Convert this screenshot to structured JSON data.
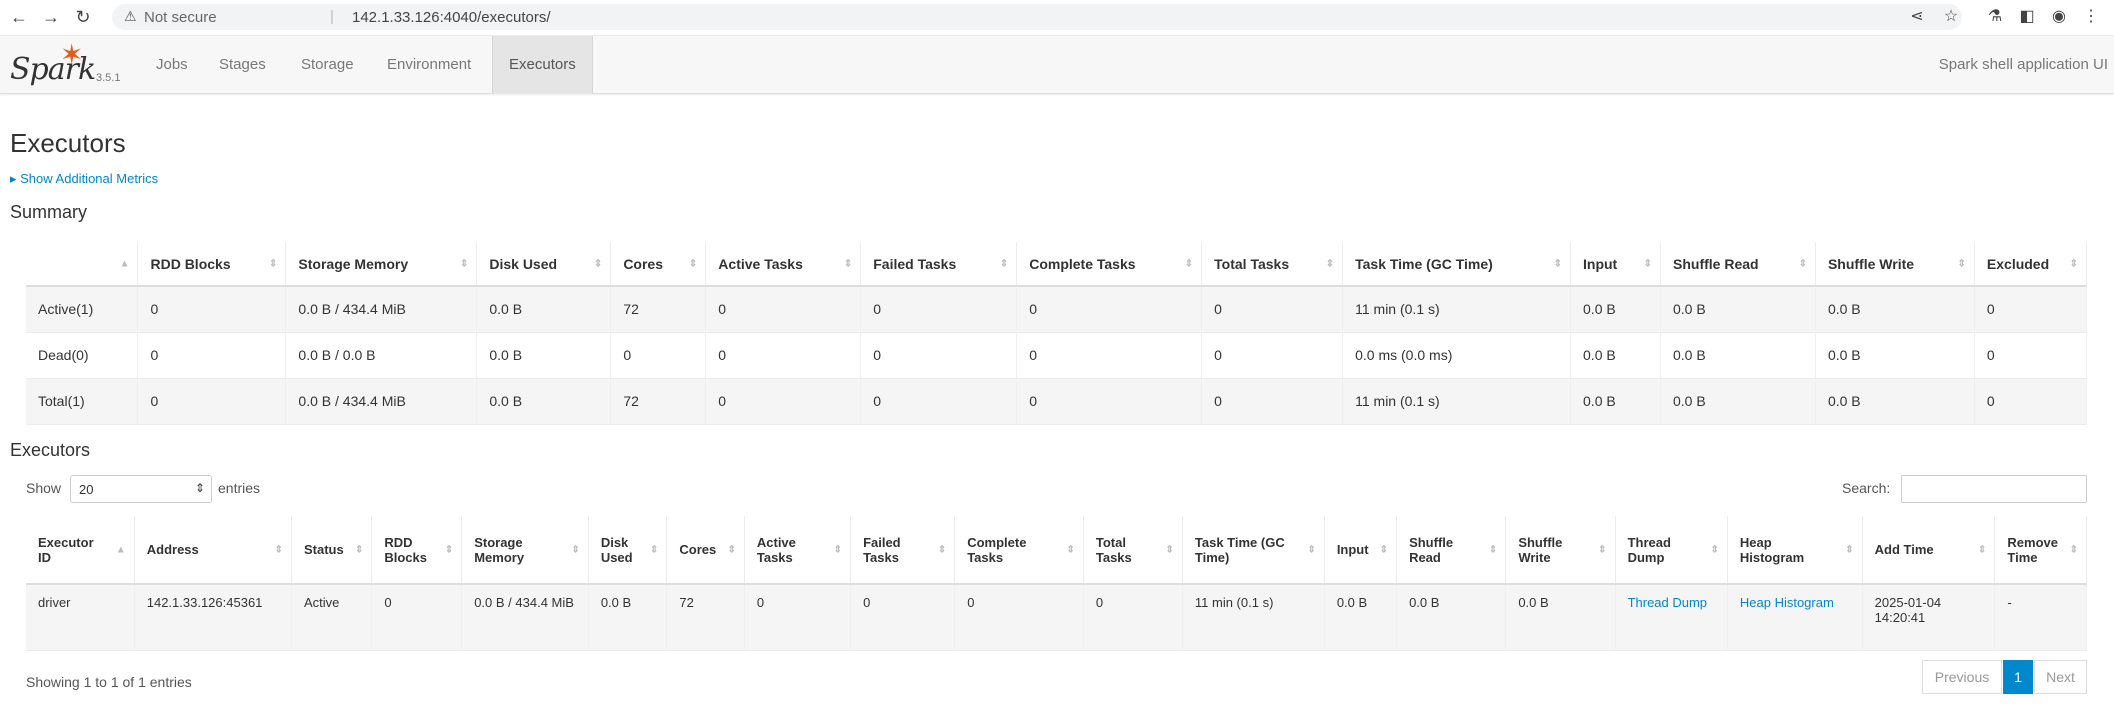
{
  "browser": {
    "security_label": "Not secure",
    "separator": "|",
    "url": "142.1.33.126:4040/executors/"
  },
  "navbar": {
    "brand_word": "Spark",
    "version": "3.5.1",
    "tabs": [
      {
        "label": "Jobs"
      },
      {
        "label": "Stages"
      },
      {
        "label": "Storage"
      },
      {
        "label": "Environment"
      },
      {
        "label": "Executors"
      }
    ],
    "active_tab": "Executors",
    "app_title": "Spark shell application UI"
  },
  "page": {
    "title": "Executors",
    "show_more": "▸ Show Additional Metrics",
    "summary_heading": "Summary",
    "executors_heading": "Executors"
  },
  "summary": {
    "columns": [
      "",
      "RDD Blocks",
      "Storage Memory",
      "Disk Used",
      "Cores",
      "Active Tasks",
      "Failed Tasks",
      "Complete Tasks",
      "Total Tasks",
      "Task Time (GC Time)",
      "Input",
      "Shuffle Read",
      "Shuffle Write",
      "Excluded"
    ],
    "rows": [
      [
        "Active(1)",
        "0",
        "0.0 B / 434.4 MiB",
        "0.0 B",
        "72",
        "0",
        "0",
        "0",
        "0",
        "11 min (0.1 s)",
        "0.0 B",
        "0.0 B",
        "0.0 B",
        "0"
      ],
      [
        "Dead(0)",
        "0",
        "0.0 B / 0.0 B",
        "0.0 B",
        "0",
        "0",
        "0",
        "0",
        "0",
        "0.0 ms (0.0 ms)",
        "0.0 B",
        "0.0 B",
        "0.0 B",
        "0"
      ],
      [
        "Total(1)",
        "0",
        "0.0 B / 434.4 MiB",
        "0.0 B",
        "72",
        "0",
        "0",
        "0",
        "0",
        "11 min (0.1 s)",
        "0.0 B",
        "0.0 B",
        "0.0 B",
        "0"
      ]
    ]
  },
  "executors_table": {
    "show_label": "Show",
    "page_size": "20",
    "entries_label": "entries",
    "search_label": "Search:",
    "columns": [
      "Executor ID",
      "Address",
      "Status",
      "RDD Blocks",
      "Storage Memory",
      "Disk Used",
      "Cores",
      "Active Tasks",
      "Failed Tasks",
      "Complete Tasks",
      "Total Tasks",
      "Task Time (GC Time)",
      "Input",
      "Shuffle Read",
      "Shuffle Write",
      "Thread Dump",
      "Heap Histogram",
      "Add Time",
      "Remove Time"
    ],
    "rows": [
      {
        "executor_id": "driver",
        "address": "142.1.33.126:45361",
        "status": "Active",
        "rdd_blocks": "0",
        "storage_memory": "0.0 B / 434.4 MiB",
        "disk_used": "0.0 B",
        "cores": "72",
        "active_tasks": "0",
        "failed_tasks": "0",
        "complete_tasks": "0",
        "total_tasks": "0",
        "task_time": "11 min (0.1 s)",
        "input": "0.0 B",
        "shuffle_read": "0.0 B",
        "shuffle_write": "0.0 B",
        "thread_dump": "Thread Dump",
        "heap_histogram": "Heap Histogram",
        "add_time": "2025-01-04 14:20:41",
        "remove_time": "-"
      }
    ],
    "info": "Showing 1 to 1 of 1 entries",
    "pager": {
      "previous": "Previous",
      "current": "1",
      "next": "Next"
    }
  },
  "colors": {
    "link": "#0088cc",
    "accent_star": "#e25a1c",
    "navbar_bg": "#f7f7f7"
  }
}
